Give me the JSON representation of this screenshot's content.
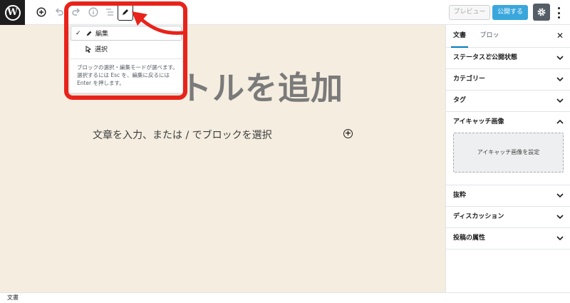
{
  "toolbar": {
    "logo_letter": "W",
    "preview_label": "プレビュー",
    "publish_label": "公開する"
  },
  "editor": {
    "title_visible": "トルを追加",
    "paragraph_placeholder": "文章を入力、または / でブロックを選択"
  },
  "mode_menu": {
    "items": [
      {
        "label": "編集",
        "checked": true,
        "icon": "pencil-icon"
      },
      {
        "label": "選択",
        "checked": false,
        "icon": "cursor-icon"
      }
    ],
    "check_mark": "✓",
    "description": "ブロックの選択・編集モードが選べます。選択するには Esc を、編集に戻るには Enter を押します。"
  },
  "sidebar": {
    "tabs": [
      {
        "label": "文書",
        "active": true
      },
      {
        "label": "ブロック",
        "active": false
      }
    ],
    "close_glyph": "✕",
    "panels": [
      {
        "label": "ステータスと公開状態",
        "expanded": false
      },
      {
        "label": "カテゴリー",
        "expanded": false
      },
      {
        "label": "タグ",
        "expanded": false
      },
      {
        "label": "アイキャッチ画像",
        "expanded": true
      },
      {
        "label": "抜粋",
        "expanded": false
      },
      {
        "label": "ディスカッション",
        "expanded": false
      },
      {
        "label": "投稿の属性",
        "expanded": false
      }
    ],
    "featured_image_button": "アイキャッチ画像を設定"
  },
  "statusbar": {
    "breadcrumb": "文書"
  },
  "colors": {
    "canvas_bg": "#f4ede0",
    "accent_blue": "#007cba",
    "publish_blue": "#3aa7dc",
    "annotation_red": "#e8231a"
  }
}
